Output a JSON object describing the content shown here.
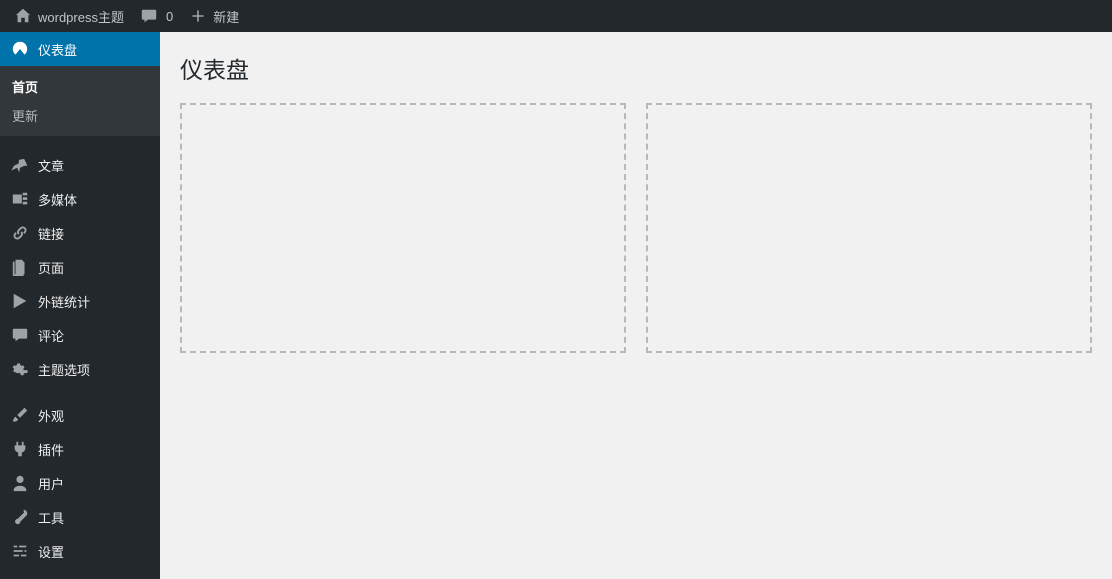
{
  "adminbar": {
    "site_title": "wordpress主题",
    "comments_count": "0",
    "new_label": "新建"
  },
  "sidebar": {
    "dashboard": "仪表盘",
    "submenu": {
      "home": "首页",
      "updates": "更新"
    },
    "posts": "文章",
    "media": "多媒体",
    "links": "链接",
    "pages": "页面",
    "external_stats": "外链统计",
    "comments": "评论",
    "theme_options": "主题选项",
    "appearance": "外观",
    "plugins": "插件",
    "users": "用户",
    "tools": "工具",
    "settings": "设置"
  },
  "content": {
    "page_title": "仪表盘"
  }
}
